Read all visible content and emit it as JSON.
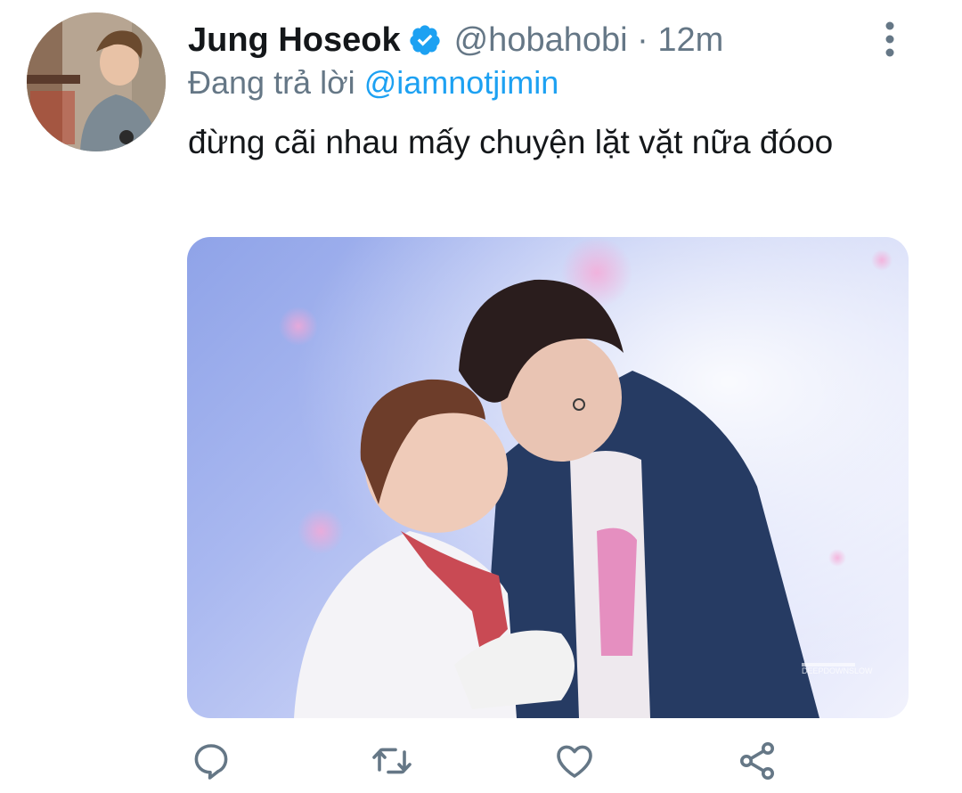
{
  "tweet": {
    "display_name": "Jung Hoseok",
    "handle": "@hobahobi",
    "separator": "·",
    "time": "12m",
    "reply_prefix": "Đang trả lời",
    "reply_to": "@iamnotjimin",
    "text": "đừng cãi nhau mấy chuyện lặt vặt nữa đóoo",
    "image_watermark": "DEEPDOWNSLOW"
  },
  "icons": {
    "verified": "verified-badge-icon",
    "more": "more-vertical-icon",
    "reply": "reply-icon",
    "retweet": "retweet-icon",
    "like": "heart-icon",
    "share": "share-icon"
  },
  "colors": {
    "text": "#14171a",
    "secondary": "#657786",
    "accent": "#1da1f2"
  }
}
